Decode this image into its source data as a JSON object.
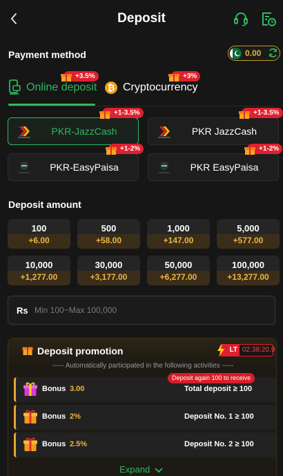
{
  "header": {
    "title": "Deposit",
    "back_icon": "back-arrow-icon",
    "support_icon": "headset-icon",
    "history_icon": "history-icon"
  },
  "payment": {
    "title": "Payment method",
    "balance": "0.00",
    "tabs": [
      {
        "label": "Online deposit",
        "badge": "+3.5%",
        "icon": "phone-wallet-icon",
        "selected": true
      },
      {
        "label": "Cryptocurrency",
        "badge": "+3%",
        "icon": "bitcoin-icon",
        "selected": false
      }
    ],
    "channels": [
      {
        "label": "PKR-JazzCash",
        "badge": "+1-3.5%",
        "selected": true
      },
      {
        "label": "PKR JazzCash",
        "badge": "+1-3.5%",
        "selected": false
      },
      {
        "label": "PKR-EasyPaisa",
        "badge": "+1-2%",
        "selected": false
      },
      {
        "label": "PKR EasyPaisa",
        "badge": "+1-2%",
        "selected": false
      }
    ]
  },
  "deposit": {
    "title": "Deposit amount",
    "amounts": [
      {
        "amount": "100",
        "bonus": "+6.00"
      },
      {
        "amount": "500",
        "bonus": "+58.00"
      },
      {
        "amount": "1,000",
        "bonus": "+147.00"
      },
      {
        "amount": "5,000",
        "bonus": "+577.00"
      },
      {
        "amount": "10,000",
        "bonus": "+1,277.00"
      },
      {
        "amount": "30,000",
        "bonus": "+3,177.00"
      },
      {
        "amount": "50,000",
        "bonus": "+6,277.00"
      },
      {
        "amount": "100,000",
        "bonus": "+13,277.00"
      }
    ],
    "currency": "Rs",
    "placeholder": "Min 100~Max 100,000"
  },
  "promotion": {
    "title": "Deposit promotion",
    "lt_label": "LT",
    "countdown": "02:38:20.9",
    "subtitle": "----- Automatically participated in the following activities -----",
    "again_badge": "Deposit again 100 to receive",
    "items": [
      {
        "label": "Bonus",
        "value": "3.00",
        "condition": "Total deposit ≥ 100"
      },
      {
        "label": "Bonus",
        "value": "2%",
        "condition": "Deposit No. 1 ≥ 100"
      },
      {
        "label": "Bonus",
        "value": "2.5%",
        "condition": "Deposit No. 2 ≥ 100"
      }
    ],
    "expand_label": "Expand"
  },
  "colors": {
    "accent": "#2dbb5d",
    "badge_red": "#e0202e",
    "gold": "#f0b43e",
    "background": "#161616"
  }
}
